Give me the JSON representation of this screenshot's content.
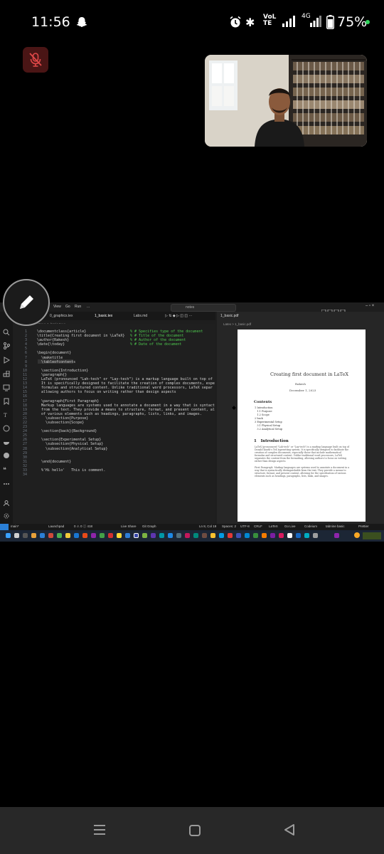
{
  "status_bar": {
    "time": "11:56",
    "volte_label": "VoLTE",
    "network": "4G",
    "battery": "75%",
    "icons": [
      "snapchat-icon",
      "alarm-icon",
      "bluetooth-icon",
      "signal-icon",
      "battery-icon"
    ]
  },
  "call": {
    "mic_state": "muted"
  },
  "vscode": {
    "menu": [
      "View",
      "Go",
      "Run",
      "..."
    ],
    "search_text": "notes",
    "tabs": [
      "0_graphics.tex",
      "1_basic.tex",
      "Labs.md",
      "1_basic.pdf"
    ],
    "breadcrumb": "Latex > 1_basic.tex > ...",
    "line_numbers": "1\n2\n3\n4\n5\n6\n7\n8\n9\n10\n11\n12\n13\n14\n15\n16\n17\n18\n19\n20\n21\n22\n23\n24\n25\n26\n27\n28\n29\n30\n31\n32\n33\n34",
    "code": "\\documentclass{article}\n\\title{Creating first document in \\LaTeX}\n\\author{Rakesh}\n\\date{\\today}\n\n\\begin{document}\n  \\maketitle\n  \\tableofcontents\n\n  \\section{Introduction}\n  \\paragraph{}\n  LaTeX (pronounced \"Lah-tech\" or \"Lay-tech\") is a markup language built on top of\n  It is specifically designed to facilitate the creation of complex documents, espe\n  formulas and structured content. Unlike traditional word processors, LaTeX separ\n  allowing authors to focus on writing rather than design aspects\n\n  \\paragraph{First Paragraph}\n  Markup languages are systems used to annotate a document in a way that is syntact\n  from the text. They provide a means to structure, format, and present content, al\n  of various elements such as headings, paragraphs, lists, links, and images.\n    \\subsection{Purpose}\n    \\subsection{Scope}\n\n  \\section{back}{Background}\n\n  \\section{Experimental Setup}\n    \\subsection{Physical Setup}\n    \\subsection{Analytical Setup}\n\n\n  \\end{document}\n\n  %'Hi hello'   This is comment.",
    "comments": "% # Specifies type of the document\n% # Title of the document\n% # Author of the document\n% # Date of the document",
    "pdf_breadcrumb": "Latex > 1_basic.pdf",
    "status_items": [
      "main*",
      "Launchpad",
      "0 ⚠ 0 ⓘ 418",
      "Live Share",
      "Git Graph",
      "Ln 8, Col 19",
      "Spaces: 2",
      "UTF-8",
      "CRLF",
      "LaTeX",
      "Go Live",
      "Codeium",
      "tabnine basic",
      "Prettier"
    ]
  },
  "pdf": {
    "title": "Creating first document in LaTeX",
    "author": "Rakesh",
    "date": "December 1, 2023",
    "contents_heading": "Contents",
    "toc": "1 Introduction\n   1.1 Purpose\n   1.2 Scope\n2 back\n3 Experimental Setup\n   3.1 Physical Setup\n   3.2 Analytical Setup",
    "intro_heading": "1   Introduction",
    "body": "LaTeX (pronounced \"Lah-tech\" or \"Lay-tech\") is a markup language built on top of Donald Knuth's TeX typesetting system. It is specifically designed to facilitate the creation of complex documents, especially those that include mathematical formulas and structured content. Unlike traditional word processors, LaTeX separates the content from the formatting, allowing authors to focus on writing rather than design aspects.\n\nFirst Paragraph  Markup languages are systems used to annotate a document in a way that is syntactically distinguishable from the text. They provide a means to structure, format, and present content, allowing for the specification of various elements such as headings, paragraphs, lists, links, and images."
  },
  "nav": {
    "icons": [
      "recents-icon",
      "home-icon",
      "back-icon"
    ]
  }
}
